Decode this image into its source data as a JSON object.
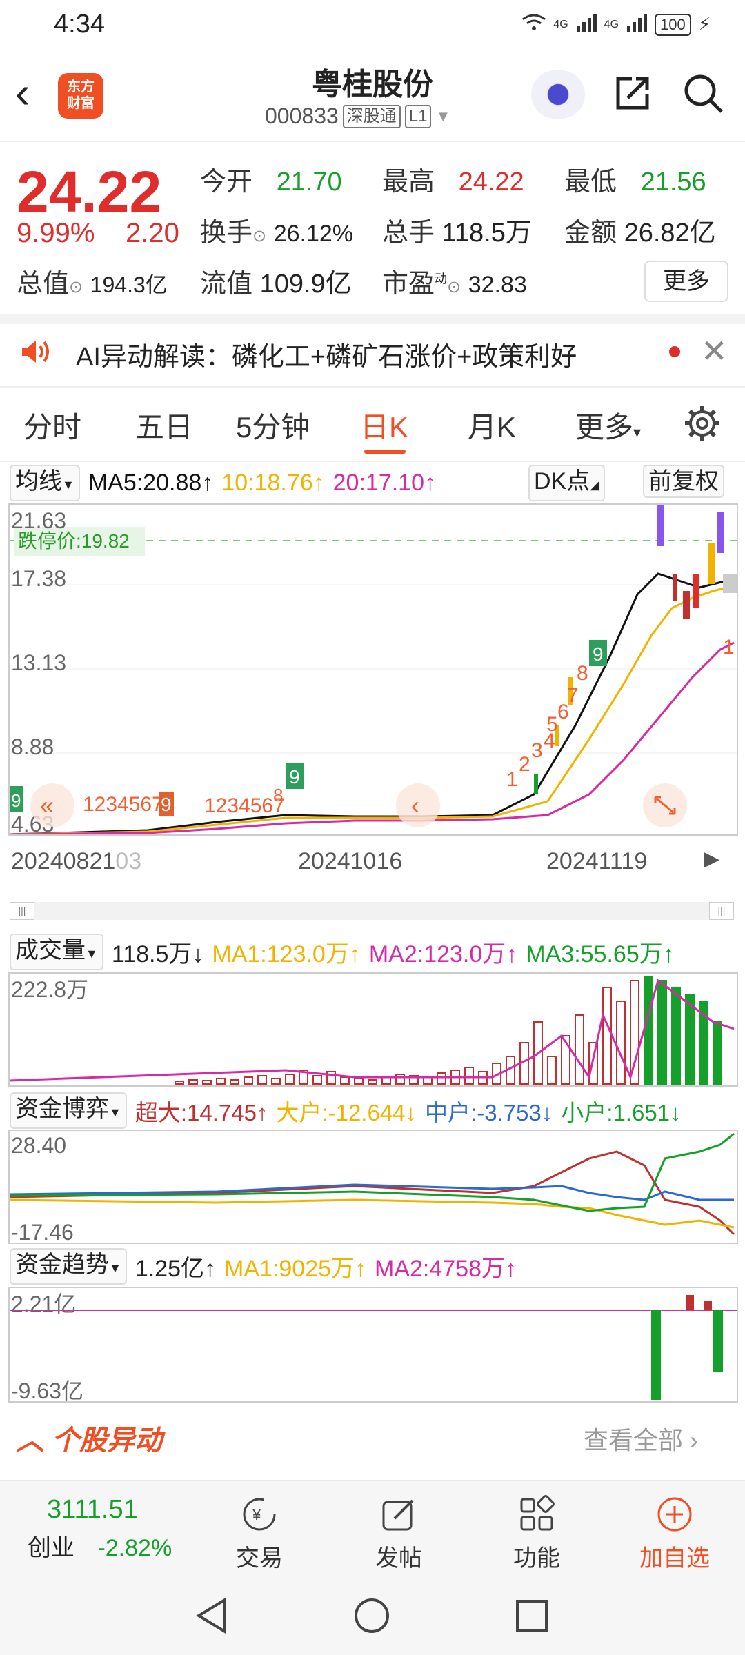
{
  "status": {
    "time": "4:34",
    "battery": "100",
    "signal1": "4G",
    "signal2": "4G"
  },
  "header": {
    "logo_line1": "东方",
    "logo_line2": "财富",
    "stock_name": "粤桂股份",
    "stock_code": "000833",
    "tag1": "深股通",
    "tag2": "L1"
  },
  "quote": {
    "price": "24.22",
    "pct": "9.99%",
    "change": "2.20",
    "open_label": "今开",
    "open": "21.70",
    "high_label": "最高",
    "high": "24.22",
    "low_label": "最低",
    "low": "21.56",
    "turnover_label": "换手",
    "turnover": "26.12%",
    "volume_label": "总手",
    "volume": "118.5万",
    "amount_label": "金额",
    "amount": "26.82亿",
    "mcap_label": "总值",
    "mcap": "194.3亿",
    "float_label": "流值",
    "float": "109.9亿",
    "pe_label": "市盈",
    "pe_sup": "动",
    "pe": "32.83",
    "more": "更多"
  },
  "ai": {
    "text": "AI异动解读：磷化工+磷矿石涨价+政策利好"
  },
  "tabs": [
    "分时",
    "五日",
    "5分钟",
    "日K",
    "月K",
    "更多"
  ],
  "active_tab": "日K",
  "kline": {
    "ma_chip": "均线",
    "ma5": "MA5:20.88↑",
    "ma10": "10:18.76↑",
    "ma20": "20:17.10↑",
    "dk_chip": "DK点",
    "fq_chip": "前复权",
    "y_ticks": [
      "21.63",
      "17.38",
      "13.13",
      "8.88",
      "4.63"
    ],
    "limit_label": "跌停价:19.82",
    "x_ticks": [
      "20240821",
      "03",
      "20241016",
      "20241119"
    ],
    "markers_a": "1234567",
    "marker_a9": "9",
    "markers_b": "1234567",
    "marker_b8": "8",
    "marker_b9": "9",
    "marker_left9": "9",
    "seq_right": [
      "1",
      "2",
      "3",
      "4",
      "5",
      "6",
      "7",
      "8"
    ],
    "seq_right9": "9",
    "last_marker": "1"
  },
  "volume": {
    "chip": "成交量",
    "value": "118.5万↓",
    "ma1": "MA1:123.0万↑",
    "ma2": "MA2:123.0万↑",
    "ma3": "MA3:55.65万↑",
    "max": "222.8万"
  },
  "fund_game": {
    "chip": "资金博弈",
    "super": "超大:14.745↑",
    "large": "大户:-12.644↓",
    "mid": "中户:-3.753↓",
    "small": "小户:1.651↓",
    "top": "28.40",
    "bottom": "-17.46"
  },
  "fund_trend": {
    "chip": "资金趋势",
    "value": "1.25亿↑",
    "ma1": "MA1:9025万↑",
    "ma2": "MA2:4758万↑",
    "top": "2.21亿",
    "bottom": "-9.63亿"
  },
  "movement": {
    "title": "个股异动",
    "view_all": "查看全部"
  },
  "bottomnav": {
    "index_value": "3111.51",
    "index_name": "创业",
    "index_pct": "-2.82%",
    "trade": "交易",
    "post": "发帖",
    "func": "功能",
    "add": "加自选"
  },
  "colors": {
    "accent": "#f04e23",
    "up": "#e12c2c",
    "down": "#14a02a",
    "ma10": "#f0b400",
    "ma20": "#d82aa6"
  }
}
